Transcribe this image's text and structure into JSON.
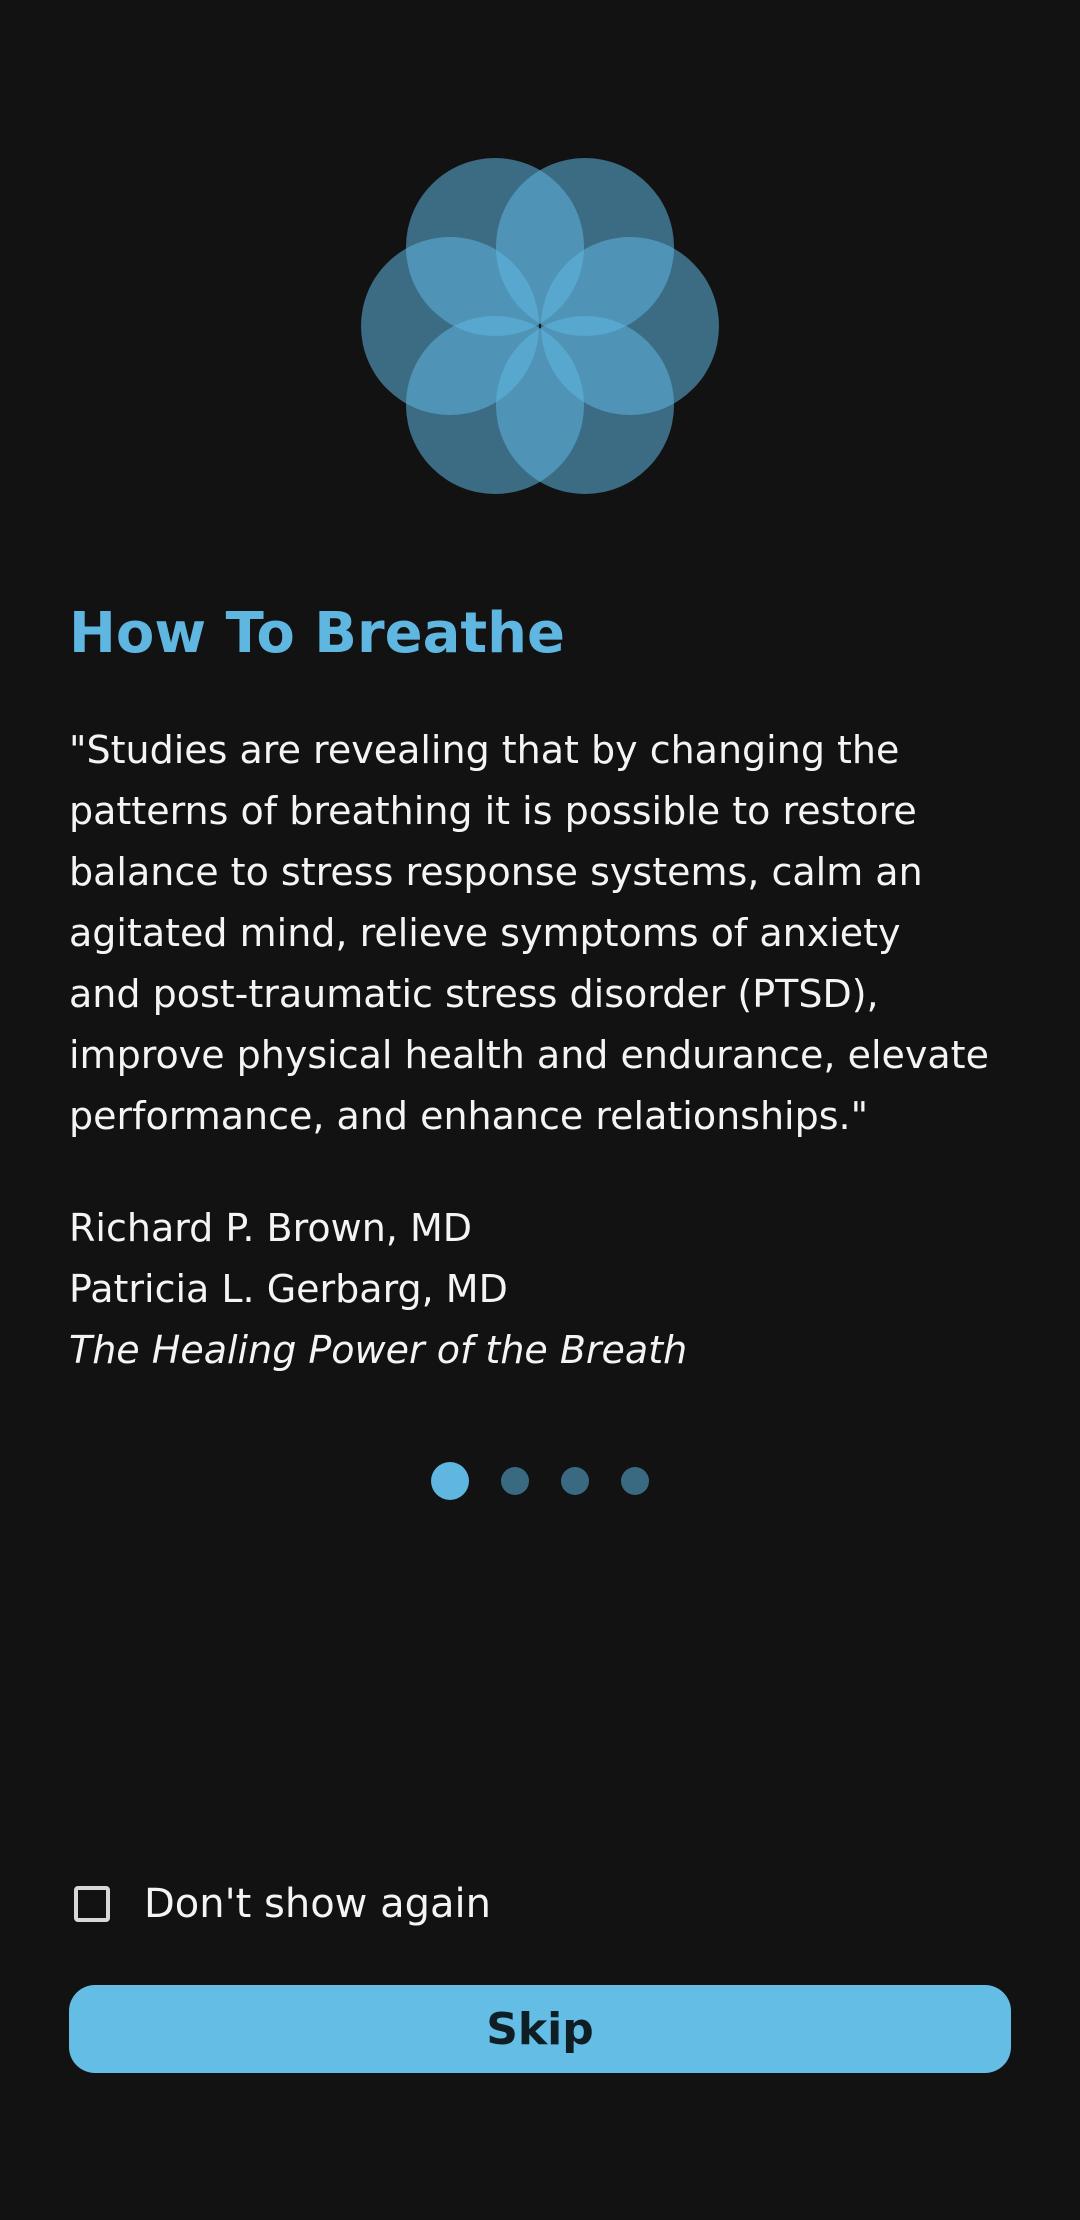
{
  "logo": {
    "icon": "flower-of-life-breathing-icon",
    "petal_color": "#5fb7e1"
  },
  "title": "How To Breathe",
  "quote": "\"Studies are revealing that by changing the\npatterns of breathing it is possible to restore\nbalance to stress response systems, calm an\nagitated mind, relieve symptoms of anxiety\nand post-traumatic stress disorder (PTSD),\nimprove physical health and endurance, elevate\nperformance, and enhance relationships.\"",
  "credits": {
    "author_1": "Richard P. Brown, MD",
    "author_2": "Patricia L. Gerbarg, MD",
    "book": "The Healing Power of the Breath"
  },
  "pager": {
    "total": 4,
    "current": 1
  },
  "dont_show_again": {
    "label": "Don't show again",
    "checked": false
  },
  "skip_button": {
    "label": "Skip"
  },
  "colors": {
    "background": "#121212",
    "accent": "#5fb7e1",
    "inactive_dot": "#3a6a82",
    "button": "#63bde4"
  }
}
